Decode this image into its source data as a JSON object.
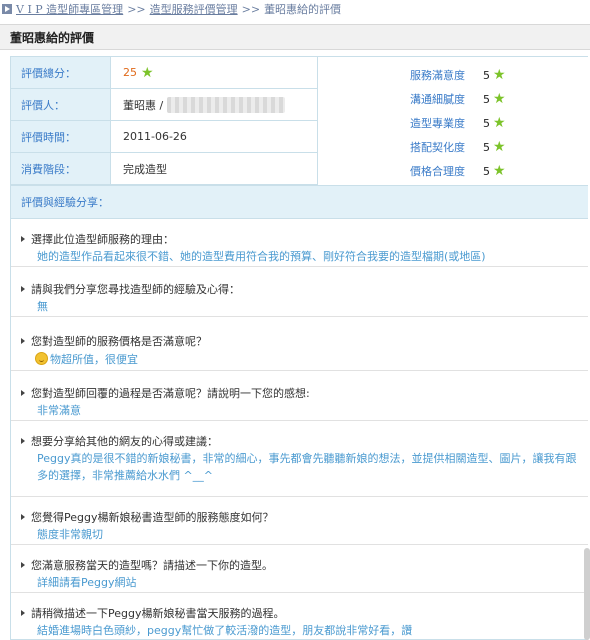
{
  "breadcrumb": {
    "root": "V I P 造型師專區管理",
    "sep1": ">>",
    "level2": "造型服務評價管理",
    "sep2": ">>",
    "current": "董昭惠給的評價"
  },
  "page_title": "董昭惠給的評價",
  "info": {
    "total_label": "評價總分：",
    "total_value": "25",
    "reviewer_label": "評價人：",
    "reviewer_value": "董昭惠 /",
    "time_label": "評價時間：",
    "time_value": "2011-06-26",
    "stage_label": "消費階段：",
    "stage_value": "完成造型"
  },
  "ratings": [
    {
      "label": "服務滿意度",
      "value": "5"
    },
    {
      "label": "溝通細膩度",
      "value": "5"
    },
    {
      "label": "造型專業度",
      "value": "5"
    },
    {
      "label": "搭配契化度",
      "value": "5"
    },
    {
      "label": "價格合理度",
      "value": "5"
    }
  ],
  "share_heading": "評價與經驗分享：",
  "qa": [
    {
      "q": "選擇此位造型師服務的理由：",
      "a": "她的造型作品看起來很不錯、她的造型費用符合我的預算、剛好符合我要的造型檔期(或地區)"
    },
    {
      "q": "請與我們分享您尋找造型師的經驗及心得：",
      "a": "無"
    },
    {
      "q": "您對造型師的服務價格是否滿意呢？",
      "a": "物超所值，很便宜"
    },
    {
      "q": "您對造型師回覆的過程是否滿意呢？請說明一下您的感想:",
      "a": "非常滿意"
    },
    {
      "q": "想要分享給其他的網友的心得或建議：",
      "a": "Peggy真的是很不錯的新娘秘書，非常的細心，事先都會先聽聽新娘的想法，並提供相關造型、圖片，讓我有跟多的選擇，非常推薦給水水們 ^__^"
    },
    {
      "q": "您覺得Peggy楊新娘秘書造型師的服務態度如何？",
      "a": "態度非常親切"
    },
    {
      "q": "您滿意服務當天的造型嗎？請描述一下你的造型。",
      "a": "詳細請看Peggy網站"
    },
    {
      "q": "請稍微描述一下Peggy楊新娘秘書當天服務的過程。",
      "a": "結婚進場時白色頭紗，peggy幫忙做了較活潑的造型，朋友都說非常好看，讚"
    }
  ]
}
